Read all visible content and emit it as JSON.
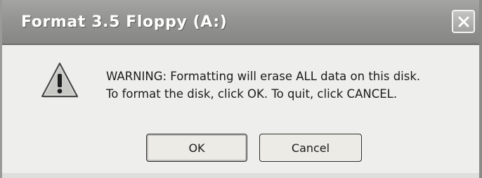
{
  "window": {
    "title": "Format 3.5 Floppy (A:)",
    "close_icon": "close-icon"
  },
  "dialog": {
    "icon": "warning-icon",
    "message_line1": "WARNING: Formatting will erase ALL data on this disk.",
    "message_line2": "To format the disk, click OK. To quit, click CANCEL."
  },
  "buttons": {
    "ok_label": "OK",
    "cancel_label": "Cancel"
  },
  "colors": {
    "titlebar": "#949492",
    "dialog_background": "#eeeeec",
    "text": "#1c1c1c"
  }
}
